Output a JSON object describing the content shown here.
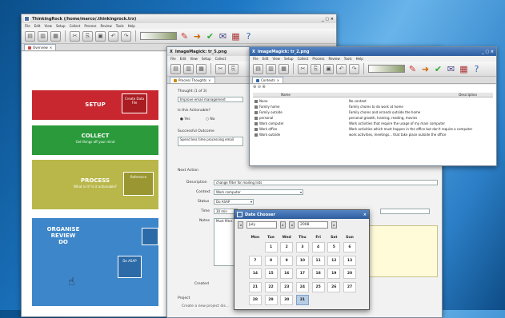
{
  "main_window": {
    "title": "ThinkingRock (/home/marco/.thinkingrock.trx)",
    "controls": "_ ▢ ×",
    "menu": [
      "File",
      "Edit",
      "View",
      "Setup",
      "Collect",
      "Process",
      "Review",
      "Tools",
      "Help"
    ],
    "tab": "Overview"
  },
  "overview": {
    "setup": "SETUP",
    "collect": "COLLECT",
    "collect_sub": "Get things off your mind",
    "process": "PROCESS",
    "process_sub": "What is it? Is it actionable?",
    "organise": "ORGANISE\nREVIEW\nDO",
    "box_create": "Create Data File",
    "box_reference": "Reference",
    "box_do_asap": "Do ASAP"
  },
  "process_window": {
    "title": "ImageMagick: tr_5.png",
    "controls": "×",
    "menu": [
      "File",
      "Edit",
      "View",
      "Setup",
      "Collect",
      "Process",
      "Tools",
      "Help"
    ],
    "tab": "Process Thoughts",
    "thought_label": "Thought (1 of 3)",
    "thought_value": "Improve email management",
    "actionable_label": "Is this Actionable?",
    "yes": "Yes",
    "no": "No",
    "outcome_label": "Successful Outcome",
    "outcome_value": "Spend less time processing email",
    "next_action": "Next Action",
    "fields": {
      "description_label": "Description",
      "description_value": "change filter for mailing lists",
      "context_label": "Context",
      "context_value": "Work computer",
      "status_label": "Status",
      "status_value": "Do ASAP",
      "time_label": "Time",
      "time_value": "30 min",
      "notes_label": "Notes",
      "notes_value": "Must filter…",
      "created_label": "Created"
    },
    "project": "Project",
    "project_text": "Create a new project dis…"
  },
  "contexts_window": {
    "title": "ImageMagick: tr_2.png",
    "controls": "_ ▢ ×",
    "menu": [
      "File",
      "Edit",
      "View",
      "Setup",
      "Collect",
      "Process",
      "Review",
      "Tools",
      "Help"
    ],
    "tab": "Contexts",
    "col_name": "Name",
    "col_desc": "Description",
    "rows": [
      {
        "name": "None",
        "desc": "No context"
      },
      {
        "name": "Family home",
        "desc": "Family chores to do work at home"
      },
      {
        "name": "Family outside",
        "desc": "Family chores and errands outside the home"
      },
      {
        "name": "personal",
        "desc": "personal growth, training, reading, movies"
      },
      {
        "name": "Work computer",
        "desc": "Work activities that require the usage of my main computer"
      },
      {
        "name": "Work office",
        "desc": "Work activities which must happen in the office but don't require a computer"
      },
      {
        "name": "Work outside",
        "desc": "work activities, meetings... that take place outside the office"
      }
    ]
  },
  "date_chooser": {
    "title": "Date Chooser",
    "month": "July",
    "year": "2008",
    "days": [
      "Mon",
      "Tue",
      "Wed",
      "Thu",
      "Fri",
      "Sat",
      "Sun"
    ],
    "weeks": [
      [
        "",
        "1",
        "2",
        "3",
        "4",
        "5",
        "6"
      ],
      [
        "7",
        "8",
        "9",
        "10",
        "11",
        "12",
        "13"
      ],
      [
        "14",
        "15",
        "16",
        "17",
        "18",
        "19",
        "20"
      ],
      [
        "21",
        "22",
        "23",
        "24",
        "25",
        "26",
        "27"
      ],
      [
        "28",
        "29",
        "30",
        "31",
        "",
        "",
        ""
      ]
    ],
    "selected": "31"
  },
  "colors": {
    "setup": "#c8272f",
    "collect": "#2a9a3b",
    "process": "#b9b74a",
    "organise": "#3d86c9",
    "titlebar": "#2d5d9e"
  }
}
